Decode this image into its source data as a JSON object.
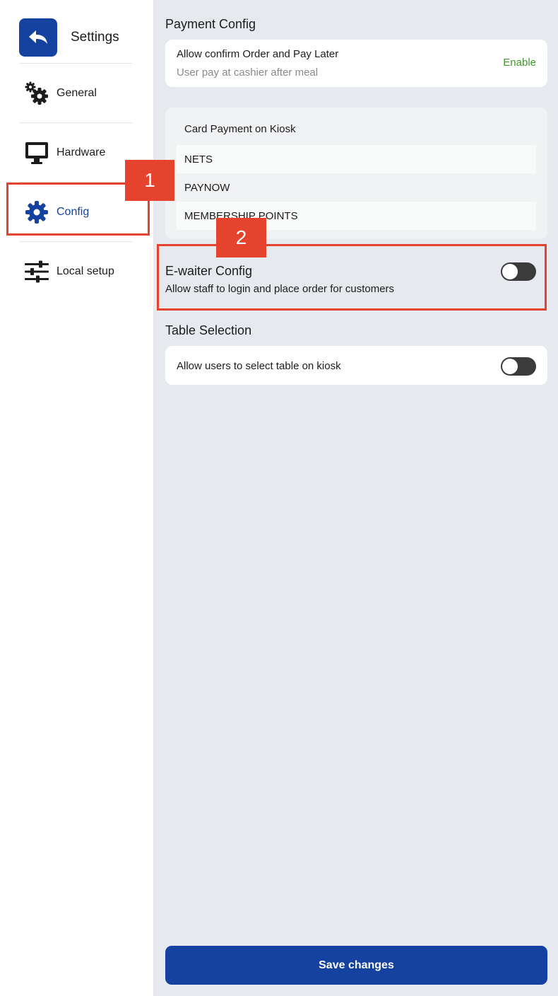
{
  "sidebar": {
    "title": "Settings",
    "items": [
      {
        "label": "General",
        "icon": "gears-icon"
      },
      {
        "label": "Hardware",
        "icon": "monitor-icon"
      },
      {
        "label": "Config",
        "icon": "gear-icon",
        "active": true
      },
      {
        "label": "Local setup",
        "icon": "sliders-icon"
      }
    ]
  },
  "payment_config": {
    "title": "Payment Config",
    "pay_later_label": "Allow confirm Order and Pay Later",
    "pay_later_sub": "User pay at cashier after meal",
    "pay_later_action": "Enable",
    "card_payment_title": "Card Payment on Kiosk",
    "methods": [
      "NETS",
      "PAYNOW",
      "MEMBERSHIP POINTS"
    ]
  },
  "ewaiter": {
    "title": "E-waiter Config",
    "description": "Allow staff to login and place order for customers",
    "enabled": false
  },
  "table_selection": {
    "title": "Table Selection",
    "label": "Allow users to select table on kiosk",
    "enabled": false
  },
  "save_label": "Save changes",
  "annotations": {
    "marker_1": "1",
    "marker_2": "2"
  },
  "colors": {
    "accent": "#1541a0",
    "enable_green": "#3d9a2a",
    "highlight_red": "#e5432e",
    "toggle_off": "#3b3b3b"
  }
}
